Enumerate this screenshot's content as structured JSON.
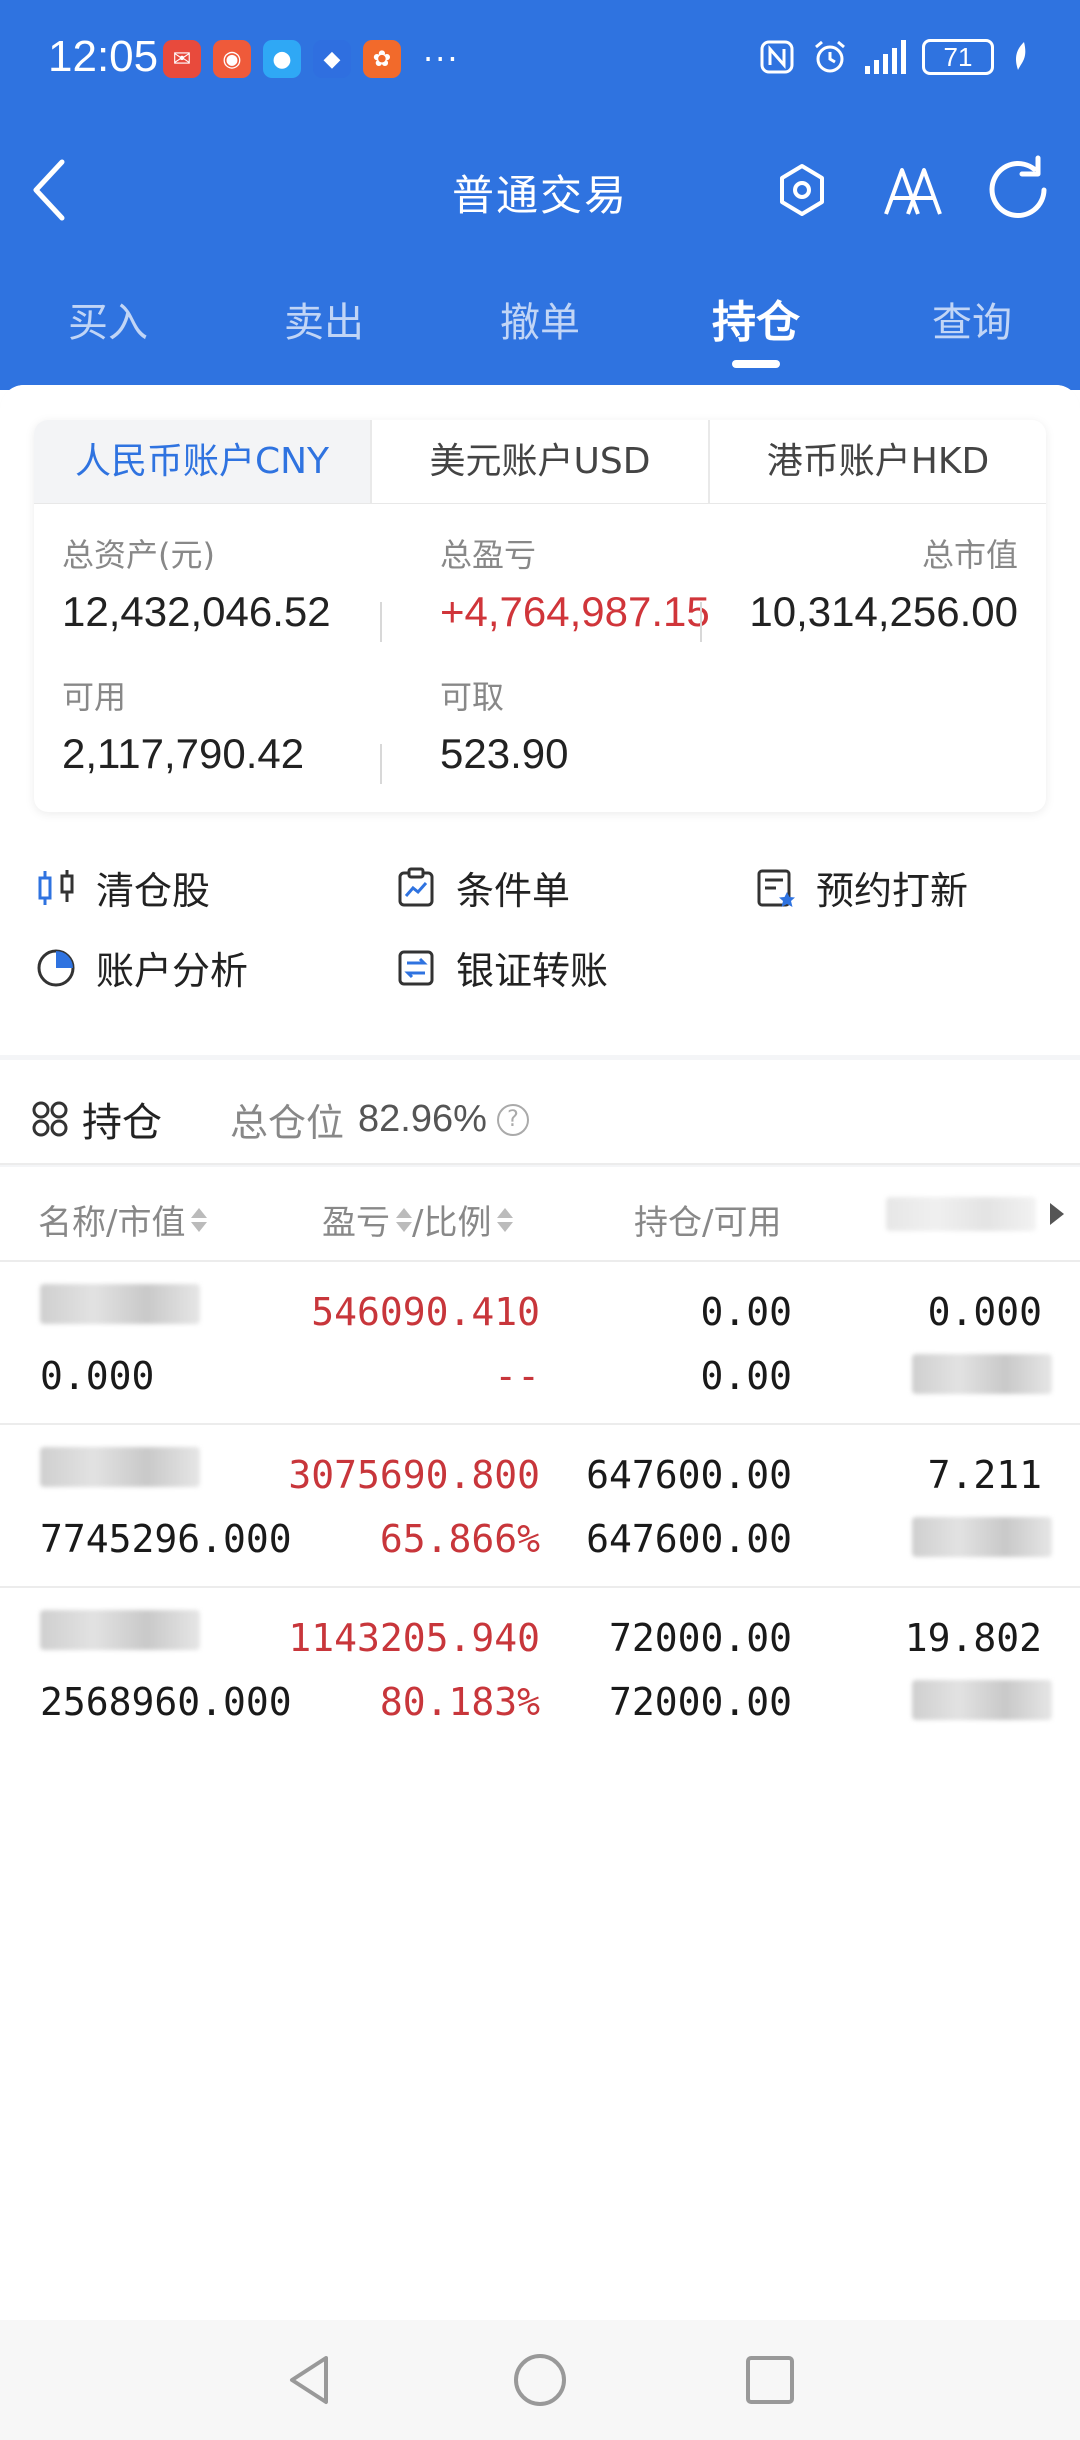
{
  "status_bar": {
    "time": "12:05",
    "apps": [
      {
        "icon": "app-icon-red",
        "color": "#e84a3c",
        "glyph": "✉"
      },
      {
        "icon": "app-icon-orange",
        "color": "#ef5a3a",
        "glyph": "◉"
      },
      {
        "icon": "app-icon-chat",
        "color": "#2fa8f5",
        "glyph": "●"
      },
      {
        "icon": "app-icon-blue",
        "color": "#2f6fe0",
        "glyph": "◆"
      },
      {
        "icon": "app-icon-orange2",
        "color": "#f26a2b",
        "glyph": "✿"
      }
    ],
    "more": "···",
    "battery": "71"
  },
  "navbar": {
    "title": "普通交易"
  },
  "tabs": [
    {
      "label": "买入",
      "active": false
    },
    {
      "label": "卖出",
      "active": false
    },
    {
      "label": "撤单",
      "active": false
    },
    {
      "label": "持仓",
      "active": true
    },
    {
      "label": "查询",
      "active": false
    }
  ],
  "account": {
    "currency_tabs": [
      {
        "label": "人民币账户CNY",
        "active": true
      },
      {
        "label": "美元账户USD",
        "active": false
      },
      {
        "label": "港币账户HKD",
        "active": false
      }
    ],
    "total_assets_label": "总资产(元)",
    "total_assets": "12,432,046.52",
    "total_pnl_label": "总盈亏",
    "total_pnl": "+4,764,987.15",
    "market_value_label": "总市值",
    "market_value": "10,314,256.00",
    "available_label": "可用",
    "available": "2,117,790.42",
    "withdrawable_label": "可取",
    "withdrawable": "523.90"
  },
  "quick_actions": [
    {
      "label": "清仓股",
      "icon": "candlestick-icon"
    },
    {
      "label": "条件单",
      "icon": "clipboard-chart-icon"
    },
    {
      "label": "预约打新",
      "icon": "calendar-star-icon"
    },
    {
      "label": "账户分析",
      "icon": "pie-chart-icon"
    },
    {
      "label": "银证转账",
      "icon": "transfer-icon"
    }
  ],
  "holdings": {
    "title": "持仓",
    "position_label": "总仓位",
    "position_value": "82.96%",
    "columns": {
      "name": "名称/市值",
      "pnl": "盈亏",
      "ratio": "/比例",
      "qty": "持仓/可用"
    },
    "rows": [
      {
        "market_value": "0.000",
        "pnl": "546090.410",
        "ratio": "--",
        "position": "0.00",
        "available": "0.00",
        "price": "0.000"
      },
      {
        "market_value": "7745296.000",
        "pnl": "3075690.800",
        "ratio": "65.866%",
        "position": "647600.00",
        "available": "647600.00",
        "price": "7.211"
      },
      {
        "market_value": "2568960.000",
        "pnl": "1143205.940",
        "ratio": "80.183%",
        "position": "72000.00",
        "available": "72000.00",
        "price": "19.802"
      }
    ]
  },
  "colors": {
    "primary": "#2f73e0",
    "loss_profit_red": "#c8363b"
  }
}
